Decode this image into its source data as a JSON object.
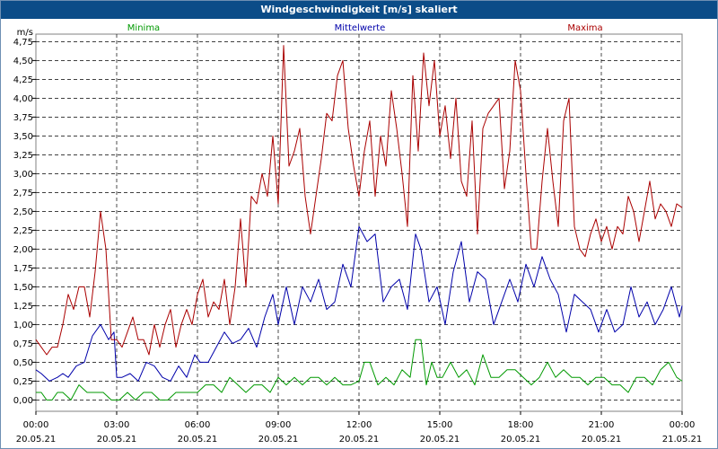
{
  "window": {
    "title": "Windgeschwindigkeit [m/s] skaliert"
  },
  "chart_data": {
    "type": "line",
    "title": "Windgeschwindigkeit [m/s] skaliert",
    "ylabel": "m/s",
    "xlabel": "",
    "ylim": [
      -0.15,
      4.85
    ],
    "xlim": [
      0,
      24
    ],
    "grid": true,
    "legend_position": "top",
    "yticks": [
      {
        "v": 0.0,
        "label": "0,00"
      },
      {
        "v": 0.25,
        "label": "0,25"
      },
      {
        "v": 0.5,
        "label": "0,50"
      },
      {
        "v": 0.75,
        "label": "0,75"
      },
      {
        "v": 1.0,
        "label": "1,00"
      },
      {
        "v": 1.25,
        "label": "1,25"
      },
      {
        "v": 1.5,
        "label": "1,50"
      },
      {
        "v": 1.75,
        "label": "1,75"
      },
      {
        "v": 2.0,
        "label": "2,00"
      },
      {
        "v": 2.25,
        "label": "2,25"
      },
      {
        "v": 2.5,
        "label": "2,50"
      },
      {
        "v": 2.75,
        "label": "2,75"
      },
      {
        "v": 3.0,
        "label": "3,00"
      },
      {
        "v": 3.25,
        "label": "3,25"
      },
      {
        "v": 3.5,
        "label": "3,50"
      },
      {
        "v": 3.75,
        "label": "3,75"
      },
      {
        "v": 4.0,
        "label": "4,00"
      },
      {
        "v": 4.25,
        "label": "4,25"
      },
      {
        "v": 4.5,
        "label": "4,50"
      },
      {
        "v": 4.75,
        "label": "4,75"
      }
    ],
    "xticks": [
      {
        "v": 0,
        "time": "00:00",
        "date": "20.05.21"
      },
      {
        "v": 3,
        "time": "03:00",
        "date": "20.05.21"
      },
      {
        "v": 6,
        "time": "06:00",
        "date": "20.05.21"
      },
      {
        "v": 9,
        "time": "09:00",
        "date": "20.05.21"
      },
      {
        "v": 12,
        "time": "12:00",
        "date": "20.05.21"
      },
      {
        "v": 15,
        "time": "15:00",
        "date": "20.05.21"
      },
      {
        "v": 18,
        "time": "18:00",
        "date": "20.05.21"
      },
      {
        "v": 21,
        "time": "21:00",
        "date": "20.05.21"
      },
      {
        "v": 24,
        "time": "00:00",
        "date": "21.05.21"
      }
    ],
    "series": [
      {
        "name": "Minima",
        "color": "#009900",
        "x": [
          0,
          0.2,
          0.4,
          0.6,
          0.8,
          1,
          1.3,
          1.6,
          1.9,
          2.2,
          2.5,
          2.8,
          3.1,
          3.4,
          3.7,
          4,
          4.3,
          4.6,
          4.9,
          5.2,
          5.5,
          5.8,
          6,
          6.3,
          6.6,
          6.9,
          7.2,
          7.5,
          7.8,
          8.1,
          8.4,
          8.7,
          9,
          9.3,
          9.6,
          9.9,
          10.2,
          10.5,
          10.8,
          11.1,
          11.4,
          11.7,
          12,
          12.2,
          12.4,
          12.7,
          13,
          13.3,
          13.6,
          13.9,
          14.1,
          14.3,
          14.5,
          14.7,
          14.9,
          15.1,
          15.4,
          15.7,
          16,
          16.3,
          16.6,
          16.9,
          17.2,
          17.5,
          17.8,
          18.1,
          18.4,
          18.7,
          19,
          19.3,
          19.6,
          19.9,
          20.2,
          20.5,
          20.8,
          21.1,
          21.4,
          21.7,
          22,
          22.3,
          22.6,
          22.9,
          23.2,
          23.5,
          23.8,
          24
        ],
        "values": [
          0.1,
          0.1,
          0.0,
          0.0,
          0.1,
          0.1,
          0.0,
          0.2,
          0.1,
          0.1,
          0.1,
          0.0,
          0.0,
          0.1,
          0.0,
          0.1,
          0.1,
          0.0,
          0.0,
          0.1,
          0.1,
          0.1,
          0.1,
          0.2,
          0.2,
          0.1,
          0.3,
          0.2,
          0.1,
          0.2,
          0.2,
          0.1,
          0.3,
          0.2,
          0.3,
          0.2,
          0.3,
          0.3,
          0.2,
          0.3,
          0.2,
          0.2,
          0.25,
          0.5,
          0.5,
          0.2,
          0.3,
          0.2,
          0.4,
          0.3,
          0.8,
          0.8,
          0.2,
          0.5,
          0.3,
          0.3,
          0.5,
          0.3,
          0.4,
          0.2,
          0.6,
          0.3,
          0.3,
          0.4,
          0.4,
          0.3,
          0.2,
          0.3,
          0.5,
          0.3,
          0.4,
          0.3,
          0.3,
          0.2,
          0.3,
          0.3,
          0.2,
          0.2,
          0.1,
          0.3,
          0.3,
          0.2,
          0.4,
          0.5,
          0.3,
          0.25
        ]
      },
      {
        "name": "Mittelwerte",
        "color": "#0000aa",
        "x": [
          0,
          0.2,
          0.5,
          0.8,
          1,
          1.2,
          1.5,
          1.8,
          2.1,
          2.4,
          2.7,
          2.9,
          3,
          3.2,
          3.5,
          3.8,
          4.1,
          4.4,
          4.7,
          5,
          5.3,
          5.6,
          5.9,
          6.1,
          6.4,
          6.7,
          7,
          7.3,
          7.6,
          7.9,
          8.2,
          8.5,
          8.8,
          9,
          9.3,
          9.6,
          9.9,
          10.2,
          10.5,
          10.8,
          11.1,
          11.4,
          11.7,
          12,
          12.3,
          12.6,
          12.9,
          13.2,
          13.5,
          13.8,
          14.1,
          14.3,
          14.6,
          14.9,
          15.2,
          15.5,
          15.8,
          16.1,
          16.4,
          16.7,
          17,
          17.3,
          17.6,
          17.9,
          18.2,
          18.5,
          18.8,
          19.1,
          19.4,
          19.7,
          20,
          20.3,
          20.6,
          20.9,
          21.2,
          21.5,
          21.8,
          22.1,
          22.4,
          22.7,
          23,
          23.3,
          23.6,
          23.9,
          24
        ],
        "values": [
          0.4,
          0.35,
          0.25,
          0.3,
          0.35,
          0.3,
          0.45,
          0.5,
          0.85,
          1.0,
          0.8,
          0.9,
          0.3,
          0.3,
          0.35,
          0.25,
          0.5,
          0.45,
          0.3,
          0.25,
          0.45,
          0.3,
          0.6,
          0.5,
          0.5,
          0.7,
          0.9,
          0.75,
          0.8,
          0.95,
          0.7,
          1.1,
          1.4,
          1.0,
          1.5,
          1.0,
          1.5,
          1.3,
          1.6,
          1.2,
          1.3,
          1.8,
          1.5,
          2.3,
          2.1,
          2.2,
          1.3,
          1.5,
          1.6,
          1.2,
          2.2,
          2.0,
          1.3,
          1.5,
          1.0,
          1.7,
          2.1,
          1.3,
          1.7,
          1.6,
          1.0,
          1.3,
          1.6,
          1.3,
          1.8,
          1.5,
          1.9,
          1.6,
          1.4,
          0.9,
          1.4,
          1.3,
          1.2,
          0.9,
          1.2,
          0.9,
          1.0,
          1.5,
          1.1,
          1.3,
          1.0,
          1.2,
          1.5,
          1.1,
          1.25
        ]
      },
      {
        "name": "Maxima",
        "color": "#aa0000",
        "x": [
          0,
          0.2,
          0.4,
          0.6,
          0.8,
          1,
          1.2,
          1.4,
          1.6,
          1.8,
          2.0,
          2.2,
          2.4,
          2.6,
          2.8,
          3.0,
          3.2,
          3.4,
          3.6,
          3.8,
          4.0,
          4.2,
          4.4,
          4.6,
          4.8,
          5.0,
          5.2,
          5.4,
          5.6,
          5.8,
          6.0,
          6.2,
          6.4,
          6.6,
          6.8,
          7.0,
          7.2,
          7.4,
          7.6,
          7.8,
          8.0,
          8.2,
          8.4,
          8.6,
          8.8,
          9.0,
          9.2,
          9.4,
          9.6,
          9.8,
          10.0,
          10.2,
          10.4,
          10.6,
          10.8,
          11.0,
          11.2,
          11.4,
          11.6,
          11.8,
          12.0,
          12.2,
          12.4,
          12.6,
          12.8,
          13.0,
          13.2,
          13.4,
          13.6,
          13.8,
          14.0,
          14.2,
          14.4,
          14.6,
          14.8,
          15.0,
          15.2,
          15.4,
          15.6,
          15.8,
          16.0,
          16.2,
          16.4,
          16.6,
          16.8,
          17.0,
          17.2,
          17.4,
          17.6,
          17.8,
          18.0,
          18.2,
          18.4,
          18.6,
          18.8,
          19.0,
          19.2,
          19.4,
          19.6,
          19.8,
          20.0,
          20.2,
          20.4,
          20.6,
          20.8,
          21.0,
          21.2,
          21.4,
          21.6,
          21.8,
          22.0,
          22.2,
          22.4,
          22.6,
          22.8,
          23.0,
          23.2,
          23.4,
          23.6,
          23.8,
          24.0
        ],
        "values": [
          0.8,
          0.7,
          0.6,
          0.7,
          0.7,
          1.0,
          1.4,
          1.2,
          1.5,
          1.5,
          1.1,
          1.7,
          2.5,
          2.0,
          0.8,
          0.8,
          0.7,
          0.9,
          1.1,
          0.8,
          0.8,
          0.6,
          1.0,
          0.7,
          1.0,
          1.2,
          0.7,
          1.0,
          1.2,
          1.0,
          1.4,
          1.6,
          1.1,
          1.3,
          1.2,
          1.6,
          1.0,
          1.5,
          2.4,
          1.5,
          2.7,
          2.6,
          3.0,
          2.7,
          3.5,
          2.6,
          4.7,
          3.1,
          3.3,
          3.6,
          2.7,
          2.2,
          2.7,
          3.2,
          3.8,
          3.7,
          4.3,
          4.5,
          3.6,
          3.1,
          2.7,
          3.3,
          3.7,
          2.7,
          3.5,
          3.1,
          4.1,
          3.6,
          3.0,
          2.3,
          4.3,
          3.3,
          4.6,
          3.9,
          4.5,
          3.5,
          3.9,
          3.2,
          4.0,
          2.9,
          2.7,
          3.7,
          2.2,
          3.6,
          3.8,
          3.9,
          4.0,
          2.8,
          3.3,
          4.5,
          4.1,
          3.0,
          2.0,
          2.0,
          2.9,
          3.6,
          2.9,
          2.3,
          3.7,
          4.0,
          2.3,
          2.0,
          1.9,
          2.2,
          2.4,
          2.1,
          2.3,
          2.0,
          2.3,
          2.2,
          2.7,
          2.5,
          2.1,
          2.5,
          2.9,
          2.4,
          2.6,
          2.5,
          2.3,
          2.6,
          2.55
        ]
      }
    ]
  }
}
